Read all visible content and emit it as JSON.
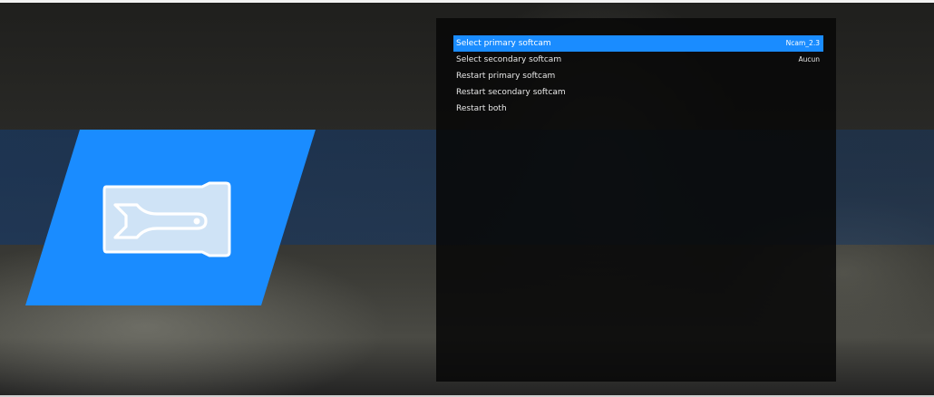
{
  "colors": {
    "accent": "#1a8cff",
    "panel_background": "#080808",
    "text": "#e8e8e8"
  },
  "plugin": {
    "icon": "softcam-key-wrench-icon"
  },
  "menu": {
    "items": [
      {
        "label": "Select primary softcam",
        "value": "Ncam_2.3",
        "selected": true
      },
      {
        "label": "Select secondary softcam",
        "value": "Aucun",
        "selected": false
      },
      {
        "label": "Restart primary softcam",
        "value": "",
        "selected": false
      },
      {
        "label": "Restart secondary softcam",
        "value": "",
        "selected": false
      },
      {
        "label": "Restart both",
        "value": "",
        "selected": false
      }
    ]
  }
}
